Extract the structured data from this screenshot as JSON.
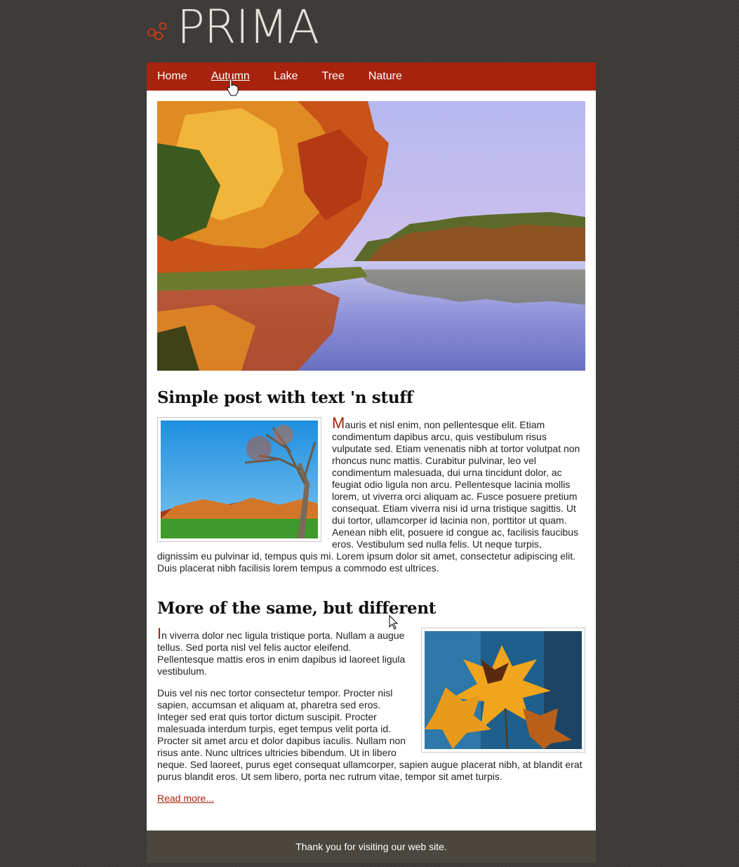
{
  "logo": {
    "text": "PRIMA"
  },
  "nav": {
    "items": [
      {
        "label": "Home"
      },
      {
        "label": "Autumn"
      },
      {
        "label": "Lake"
      },
      {
        "label": "Tree"
      },
      {
        "label": "Nature"
      }
    ],
    "active": "Autumn"
  },
  "colors": {
    "accent": "#a8230d",
    "background": "#3b3a36",
    "footer": "#4b473e",
    "content": "#ffffff"
  },
  "hero": {
    "alt": "autumn-lake-photo"
  },
  "posts": [
    {
      "title": "Simple post with text 'n stuff",
      "image": "autumn-tree-photo",
      "dropcap": "M",
      "paragraphs": [
        "auris et nisl enim, non pellentesque elit. Etiam condimentum dapibus arcu, quis vestibulum risus vulputate sed. Etiam venenatis nibh at tortor volutpat non rhoncus nunc mattis. Curabitur pulvinar, leo vel condimentum malesuada, dui urna tincidunt dolor, ac feugiat odio ligula non arcu. Pellentesque lacinia mollis lorem, ut viverra orci aliquam ac. Fusce posuere pretium consequat. Etiam viverra nisi id urna tristique sagittis. Ut dui tortor, ullamcorper id lacinia non, porttitor ut quam. Aenean nibh elit, posuere id congue ac, facilisis faucibus eros. Vestibulum sed nulla felis. Ut neque turpis, dignissim eu pulvinar id, tempus quis mi. Lorem ipsum dolor sit amet, consectetur adipiscing elit. Duis placerat nibh facilisis lorem tempus a commodo est ultrices."
      ]
    },
    {
      "title": "More of the same, but different",
      "image": "autumn-leaves-photo",
      "dropcap": "I",
      "paragraphs": [
        "n viverra dolor nec ligula tristique porta. Nullam a augue tellus. Sed porta nisl vel felis auctor eleifend. Pellentesque mattis eros in enim dapibus id laoreet ligula vestibulum.",
        "Duis vel nis nec tortor consectetur tempor. Procter nisl sapien, accumsan et aliquam at, pharetra sed eros. Integer sed erat quis tortor dictum suscipit. Procter malesuada interdum turpis, eget tempus velit porta id. Procter sit amet arcu et dolor dapibus iaculis. Nullam non risus ante. Nunc ultrices ultricies bibendum. Ut in libero neque. Sed laoreet, purus eget consequat ullamcorper, sapien augue placerat nibh, at blandit erat purus blandit eros. Ut sem libero, porta nec rutrum vitae, tempor sit amet turpis."
      ],
      "read_more": "Read more..."
    }
  ],
  "footer": {
    "text": "Thank you for visiting our web site."
  }
}
